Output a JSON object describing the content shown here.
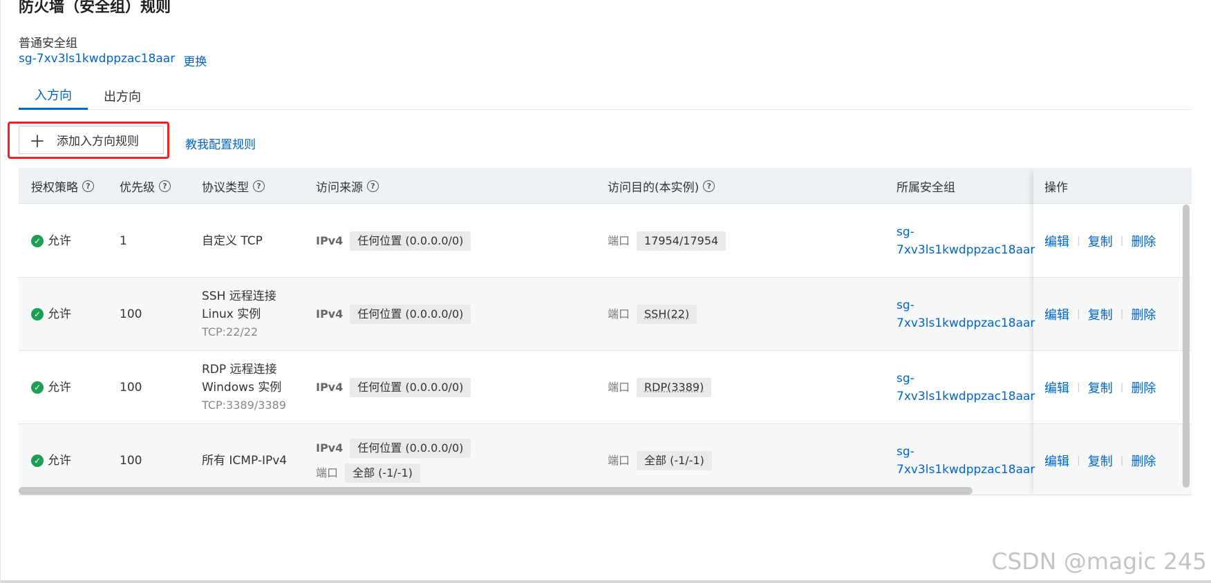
{
  "page": {
    "title": "防火墙（安全组）规则",
    "sg_type": "普通安全组",
    "sg_id": "sg-7xv3ls1kwdppzac18aar",
    "change_link": "更换"
  },
  "tabs": [
    {
      "label": "入方向",
      "active": true
    },
    {
      "label": "出方向",
      "active": false
    }
  ],
  "toolbar": {
    "add_label": "添加入方向规则",
    "teach_label": "教我配置规则"
  },
  "table": {
    "headers": {
      "policy": "授权策略",
      "priority": "优先级",
      "protocol": "协议类型",
      "source": "访问来源",
      "dest": "访问目的(本实例)",
      "group": "所属安全组",
      "ops": "操作"
    },
    "rows": [
      {
        "policy": "允许",
        "priority": "1",
        "protocol_line1": "自定义 TCP",
        "protocol_line2": "",
        "protocol_sub": "",
        "src_ipv": "IPv4",
        "src_value": "任何位置 (0.0.0.0/0)",
        "src_port_label": "",
        "src_port_value": "",
        "dest_label": "端口",
        "dest_value": "17954/17954",
        "group_line1": "sg-",
        "group_line2": "7xv3ls1kwdppzac18aar",
        "op_edit": "编辑",
        "op_copy": "复制",
        "op_delete": "删除"
      },
      {
        "policy": "允许",
        "priority": "100",
        "protocol_line1": "SSH 远程连接",
        "protocol_line2": "Linux 实例",
        "protocol_sub": "TCP:22/22",
        "src_ipv": "IPv4",
        "src_value": "任何位置 (0.0.0.0/0)",
        "src_port_label": "",
        "src_port_value": "",
        "dest_label": "端口",
        "dest_value": "SSH(22)",
        "group_line1": "sg-",
        "group_line2": "7xv3ls1kwdppzac18aar",
        "op_edit": "编辑",
        "op_copy": "复制",
        "op_delete": "删除"
      },
      {
        "policy": "允许",
        "priority": "100",
        "protocol_line1": "RDP 远程连接",
        "protocol_line2": "Windows 实例",
        "protocol_sub": "TCP:3389/3389",
        "src_ipv": "IPv4",
        "src_value": "任何位置 (0.0.0.0/0)",
        "src_port_label": "",
        "src_port_value": "",
        "dest_label": "端口",
        "dest_value": "RDP(3389)",
        "group_line1": "sg-",
        "group_line2": "7xv3ls1kwdppzac18aar",
        "op_edit": "编辑",
        "op_copy": "复制",
        "op_delete": "删除"
      },
      {
        "policy": "允许",
        "priority": "100",
        "protocol_line1": "所有 ICMP-IPv4",
        "protocol_line2": "",
        "protocol_sub": "",
        "src_ipv": "IPv4",
        "src_value": "任何位置 (0.0.0.0/0)",
        "src_port_label": "端口",
        "src_port_value": "全部 (-1/-1)",
        "dest_label": "端口",
        "dest_value": "全部 (-1/-1)",
        "group_line1": "sg-",
        "group_line2": "7xv3ls1kwdppzac18aar",
        "op_edit": "编辑",
        "op_copy": "复制",
        "op_delete": "删除"
      }
    ]
  },
  "watermark": "CSDN @magic 245",
  "colors": {
    "link": "#0064c8",
    "allow": "#1e9e52",
    "highlight_box": "#ee2222",
    "header_bg": "#eef1f5"
  }
}
